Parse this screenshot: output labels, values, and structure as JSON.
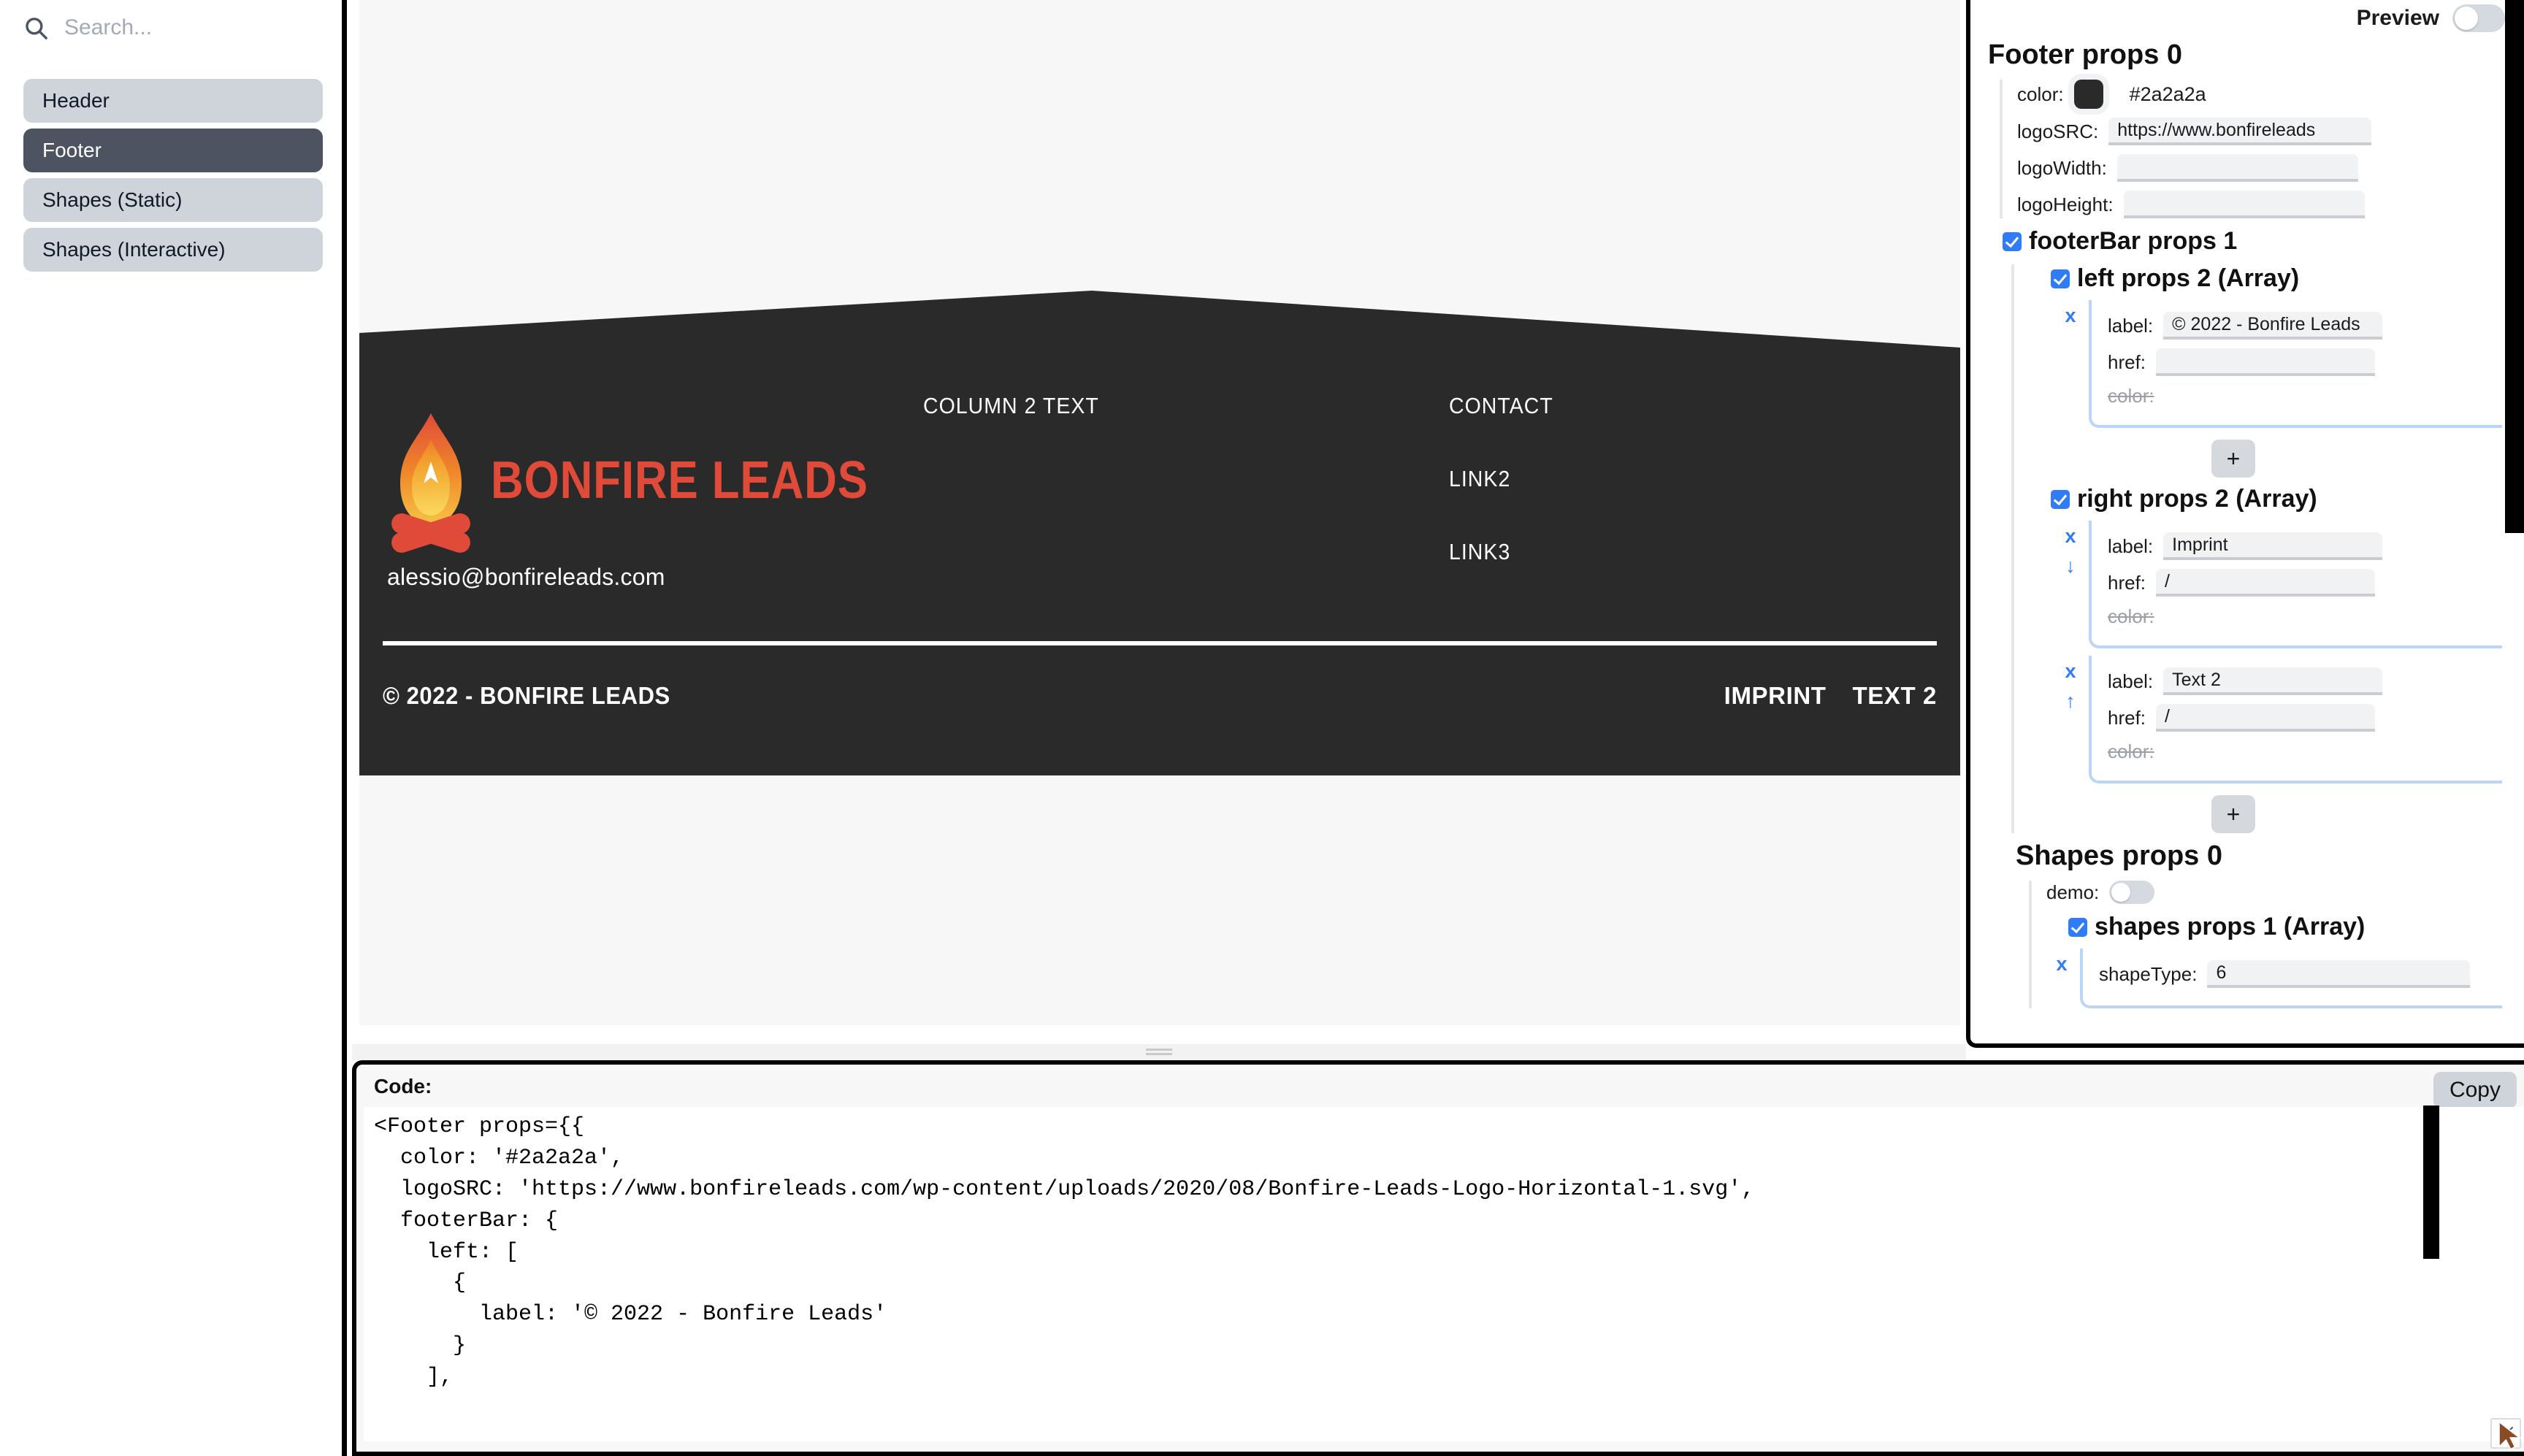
{
  "sidebar": {
    "search": {
      "placeholder": "Search...",
      "value": "",
      "icon": "search-icon"
    },
    "items": [
      {
        "label": "Header",
        "active": false
      },
      {
        "label": "Footer",
        "active": true
      },
      {
        "label": "Shapes (Static)",
        "active": false
      },
      {
        "label": "Shapes (Interactive)",
        "active": false
      }
    ]
  },
  "preview": {
    "footer": {
      "background_color": "#2a2a2a",
      "logo_text": "BONFIRE LEADS",
      "logo_color": "#e04a38",
      "email": "alessio@bonfireleads.com",
      "column2_heading": "COLUMN 2 TEXT",
      "column3_heading": "CONTACT",
      "column3_links": [
        "LINK2",
        "LINK3"
      ],
      "bar_left": "© 2022 - BONFIRE LEADS",
      "bar_right": [
        "IMPRINT",
        "TEXT 2"
      ]
    }
  },
  "props": {
    "preview_toggle_label": "Preview",
    "preview_toggle_on": false,
    "footer_title": "Footer props 0",
    "color_label": "color:",
    "color_value": "#2a2a2a",
    "logosrc_label": "logoSRC:",
    "logosrc_value": "https://www.bonfireleads",
    "logowidth_label": "logoWidth:",
    "logowidth_value": "",
    "logoheight_label": "logoHeight:",
    "logoheight_value": "",
    "footerbar_title": "footerBar props 1",
    "footerbar_checked": true,
    "left_title": "left props 2 (Array)",
    "left_checked": true,
    "left_items": [
      {
        "remove": "x",
        "label_label": "label:",
        "label_value": "© 2022 - Bonfire Leads",
        "href_label": "href:",
        "href_value": "",
        "color_label": "color:"
      }
    ],
    "left_add": "+",
    "right_title": "right props 2 (Array)",
    "right_checked": true,
    "right_items": [
      {
        "remove": "x",
        "move": "↓",
        "label_label": "label:",
        "label_value": "Imprint",
        "href_label": "href:",
        "href_value": "/",
        "color_label": "color:"
      },
      {
        "remove": "x",
        "move": "↑",
        "label_label": "label:",
        "label_value": "Text 2",
        "href_label": "href:",
        "href_value": "/",
        "color_label": "color:"
      }
    ],
    "right_add": "+",
    "shapes_title": "Shapes props 0",
    "demo_label": "demo:",
    "demo_on": false,
    "shapes_array_title": "shapes props 1 (Array)",
    "shapes_array_checked": true,
    "shapes_items": [
      {
        "remove": "x",
        "shapetype_label": "shapeType:",
        "shapetype_value": "6"
      }
    ]
  },
  "code": {
    "heading": "Code:",
    "copy_label": "Copy",
    "text": "<Footer props={{\n  color: '#2a2a2a',\n  logoSRC: 'https://www.bonfireleads.com/wp-content/uploads/2020/08/Bonfire-Leads-Logo-Horizontal-1.svg',\n  footerBar: {\n    left: [\n      {\n        label: '© 2022 - Bonfire Leads'\n      }\n    ],"
  }
}
